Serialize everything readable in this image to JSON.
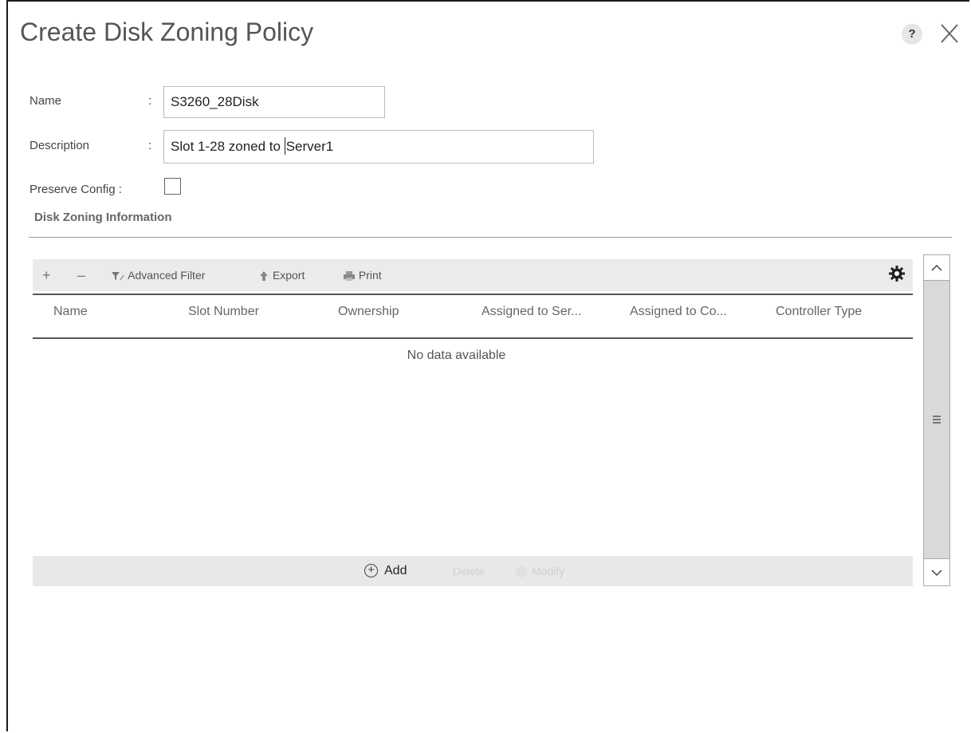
{
  "dialog": {
    "title": "Create Disk Zoning Policy",
    "help": "?"
  },
  "form": {
    "name_label": "Name",
    "name_value": "S3260_28Disk",
    "description_label": "Description",
    "description_value_before_caret": "Slot 1-28 zoned to ",
    "description_value_after_caret": "Server1",
    "preserve_label": "Preserve Config :",
    "preserve_checked": false,
    "colon": ":"
  },
  "section": {
    "title": "Disk Zoning Information"
  },
  "toolbar": {
    "add": "+",
    "remove": "–",
    "advanced_filter": "Advanced Filter",
    "export": "Export",
    "print": "Print"
  },
  "table": {
    "columns": [
      "Name",
      "Slot Number",
      "Ownership",
      "Assigned to Ser...",
      "Assigned to Co...",
      "Controller Type"
    ],
    "rows": [],
    "empty_message": "No data available"
  },
  "footer": {
    "add": "Add",
    "delete": "Delete",
    "modify": "Modify"
  },
  "colors": {
    "toolbar_bg": "#ebebeb",
    "title": "#555555"
  }
}
